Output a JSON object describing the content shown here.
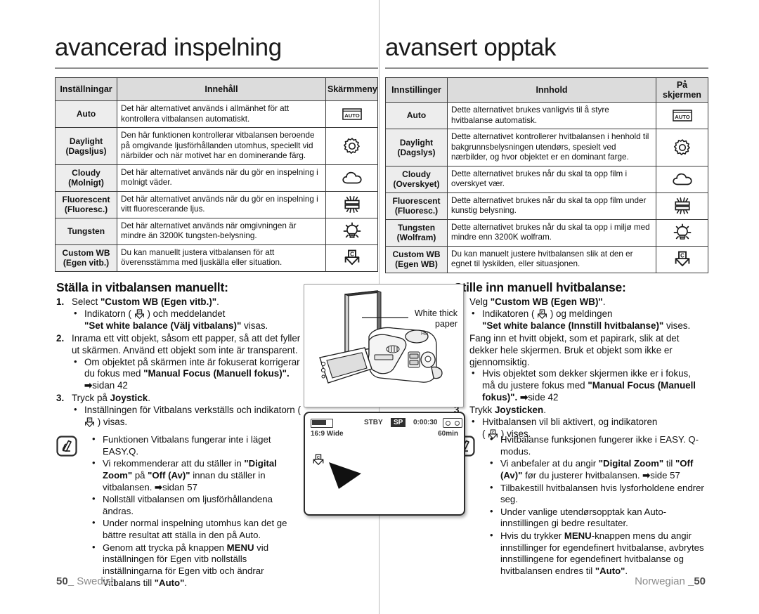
{
  "left": {
    "chapter_title": "avancerad inspelning",
    "table": {
      "headers": [
        "Inställningar",
        "Innehåll",
        "Skärmmeny"
      ],
      "rows": [
        {
          "setting": "Auto",
          "content": "Det här alternativet används i allmänhet för att kontrollera vitbalansen automatiskt.",
          "icon": "auto-icon"
        },
        {
          "setting": "Daylight\n(Dagsljus)",
          "content": "Den här funktionen kontrollerar vitbalansen beroende på omgivande ljusförhållanden utomhus, speciellt vid närbilder och när motivet har en dominerande färg.",
          "icon": "daylight-sun-icon"
        },
        {
          "setting": "Cloudy\n(Molnigt)",
          "content": "Det här alternativet används när du gör en inspelning i molnigt väder.",
          "icon": "cloudy-icon"
        },
        {
          "setting": "Fluorescent\n(Fluoresc.)",
          "content": "Det här alternativet används när du gör en inspelning i vitt fluorescerande ljus.",
          "icon": "fluorescent-icon"
        },
        {
          "setting": "Tungsten",
          "content": "Det här alternativet används när omgivningen är mindre än 3200K tungsten-belysning.",
          "icon": "tungsten-icon"
        },
        {
          "setting": "Custom WB\n(Egen vitb.)",
          "content": "Du kan manuellt justera vitbalansen för att överensstämma med ljuskälla eller situation.",
          "icon": "custom-wb-icon"
        }
      ]
    },
    "howto_title": "Ställa in vitbalansen manuellt:",
    "steps": [
      {
        "num": "1.",
        "text_parts": [
          {
            "t": "Select ",
            "b": false
          },
          {
            "t": "\"Custom WB (Egen vitb.)\"",
            "b": true
          },
          {
            "t": ".",
            "b": false
          }
        ],
        "subs": [
          {
            "parts": [
              {
                "t": "Indikatorn ( ",
                "b": false
              },
              {
                "icon": "custom-wb-icon"
              },
              {
                "t": " ) och meddelandet ",
                "b": false
              },
              {
                "br": true
              },
              {
                "t": "\"Set white balance (Välj vitbalans)\"",
                "b": true
              },
              {
                "t": " visas.",
                "b": false
              }
            ]
          }
        ]
      },
      {
        "num": "2.",
        "text_parts": [
          {
            "t": "Inrama ett vitt objekt, såsom ett papper, så att det fyller ut skärmen. Använd ett objekt som inte är transparent.",
            "b": false
          }
        ],
        "subs": [
          {
            "parts": [
              {
                "t": "Om objektet på skärmen inte är fokuserat korrigerar du fokus med ",
                "b": false
              },
              {
                "t": "\"Manual Focus (Manuell fokus)\".",
                "b": true
              },
              {
                "t": " ",
                "b": false
              },
              {
                "t": "➡",
                "b": true
              },
              {
                "t": "sidan 42",
                "b": false
              }
            ]
          }
        ]
      },
      {
        "num": "3.",
        "text_parts": [
          {
            "t": "Tryck på ",
            "b": false
          },
          {
            "t": "Joystick",
            "b": true
          },
          {
            "t": ".",
            "b": false
          }
        ],
        "subs": [
          {
            "parts": [
              {
                "t": "Inställningen för Vitbalans verkställs och indikatorn ( ",
                "b": false
              },
              {
                "icon": "custom-wb-icon"
              },
              {
                "t": " ) visas.",
                "b": false
              }
            ]
          }
        ]
      }
    ],
    "notes": [
      {
        "parts": [
          {
            "t": "Funktionen Vitbalans fungerar inte i läget EASY.Q.",
            "b": false
          }
        ]
      },
      {
        "parts": [
          {
            "t": "Vi rekommenderar att du ställer in ",
            "b": false
          },
          {
            "t": "\"Digital Zoom\"",
            "b": true
          },
          {
            "t": " på ",
            "b": false
          },
          {
            "t": "\"Off (Av)\"",
            "b": true
          },
          {
            "t": " innan du ställer in vitbalansen. ",
            "b": false
          },
          {
            "t": "➡",
            "b": true
          },
          {
            "t": "sidan 57",
            "b": false
          }
        ]
      },
      {
        "parts": [
          {
            "t": "Nollställ vitbalansen om ljusförhållandena ändras.",
            "b": false
          }
        ]
      },
      {
        "parts": [
          {
            "t": "Under normal inspelning utomhus kan det ge bättre resultat att ställa in den på Auto.",
            "b": false
          }
        ]
      },
      {
        "parts": [
          {
            "t": "Genom att trycka på knappen ",
            "b": false
          },
          {
            "t": "MENU",
            "b": true
          },
          {
            "t": " vid inställningen för Egen vitb nollställs inställningarna för Egen vitb och ändrar Vitbalans till ",
            "b": false
          },
          {
            "t": "\"Auto\"",
            "b": true
          },
          {
            "t": ".",
            "b": false
          }
        ]
      }
    ],
    "footer_page": "50",
    "footer_language": "Swedish"
  },
  "right": {
    "chapter_title": "avansert opptak",
    "table": {
      "headers": [
        "Innstillinger",
        "Innhold",
        "På skjermen"
      ],
      "rows": [
        {
          "setting": "Auto",
          "content": "Dette alternativet brukes vanligvis til å styre hvitbalanse automatisk.",
          "icon": "auto-icon"
        },
        {
          "setting": "Daylight\n(Dagslys)",
          "content": "Dette alternativet kontrollerer hvitbalansen i henhold til bakgrunnsbelysningen utendørs, spesielt ved nærbilder, og hvor objektet er en dominant farge.",
          "icon": "daylight-sun-icon"
        },
        {
          "setting": "Cloudy\n(Overskyet)",
          "content": "Dette alternativet brukes når du skal ta opp film i overskyet vær.",
          "icon": "cloudy-icon"
        },
        {
          "setting": "Fluorescent\n(Fluoresc.)",
          "content": "Dette alternativet brukes når du skal ta opp film under kunstig belysning.",
          "icon": "fluorescent-icon"
        },
        {
          "setting": "Tungsten\n(Wolfram)",
          "content": "Dette alternativet brukes når du skal ta opp i miljø med mindre enn 3200K wolfram.",
          "icon": "tungsten-icon"
        },
        {
          "setting": "Custom WB\n(Egen WB)",
          "content": "Du kan manuelt justere hvitbalansen slik at den er egnet til lyskilden, eller situasjonen.",
          "icon": "custom-wb-icon"
        }
      ]
    },
    "howto_title": "Stille inn manuell hvitbalanse:",
    "steps": [
      {
        "num": "1.",
        "text_parts": [
          {
            "t": "Velg ",
            "b": false
          },
          {
            "t": "\"Custom WB (Egen WB)\"",
            "b": true
          },
          {
            "t": ".",
            "b": false
          }
        ],
        "subs": [
          {
            "parts": [
              {
                "t": "Indikatoren ( ",
                "b": false
              },
              {
                "icon": "custom-wb-icon"
              },
              {
                "t": " ) og meldingen ",
                "b": false
              },
              {
                "br": true
              },
              {
                "t": "\"Set white balance (Innstill hvitbalanse)\"",
                "b": true
              },
              {
                "t": " vises.",
                "b": false
              }
            ]
          }
        ]
      },
      {
        "num": "2.",
        "text_parts": [
          {
            "t": "Fang inn et hvitt objekt, som et papirark, slik at det dekker hele skjermen. Bruk et objekt som ikke er gjennomsiktig.",
            "b": false
          }
        ],
        "subs": [
          {
            "parts": [
              {
                "t": "Hvis objektet som dekker skjermen ikke er i fokus, må du justere fokus med ",
                "b": false
              },
              {
                "t": "\"Manual Focus (Manuell fokus)\".",
                "b": true
              },
              {
                "t": " ",
                "b": false
              },
              {
                "t": "➡",
                "b": true
              },
              {
                "t": "side 42",
                "b": false
              }
            ]
          }
        ]
      },
      {
        "num": "3.",
        "text_parts": [
          {
            "t": "Trykk ",
            "b": false
          },
          {
            "t": "Joysticken",
            "b": true
          },
          {
            "t": ".",
            "b": false
          }
        ],
        "subs": [
          {
            "parts": [
              {
                "t": "Hvitbalansen vil bli aktivert, og indikatoren ",
                "b": false
              },
              {
                "br": true
              },
              {
                "t": "( ",
                "b": false
              },
              {
                "icon": "custom-wb-icon"
              },
              {
                "t": " ) vises.",
                "b": false
              }
            ]
          }
        ]
      }
    ],
    "notes": [
      {
        "parts": [
          {
            "t": "Hvitbalanse funksjonen fungerer ikke i EASY. Q-modus.",
            "b": false
          }
        ]
      },
      {
        "parts": [
          {
            "t": "Vi anbefaler at du angir ",
            "b": false
          },
          {
            "t": "\"Digital Zoom\"",
            "b": true
          },
          {
            "t": " til ",
            "b": false
          },
          {
            "t": "\"Off (Av)\"",
            "b": true
          },
          {
            "t": " før du justerer hvitbalansen. ",
            "b": false
          },
          {
            "t": "➡",
            "b": true
          },
          {
            "t": "side 57",
            "b": false
          }
        ]
      },
      {
        "parts": [
          {
            "t": "Tilbakestill hvitbalansen hvis lysforholdene endrer seg.",
            "b": false
          }
        ]
      },
      {
        "parts": [
          {
            "t": "Under vanlige utendørsopptak kan Auto-innstillingen gi bedre resultater.",
            "b": false
          }
        ]
      },
      {
        "parts": [
          {
            "t": "Hvis du trykker ",
            "b": false
          },
          {
            "t": "MENU",
            "b": true
          },
          {
            "t": "-knappen mens du angir innstillinger for egendefinert hvitbalanse, avbrytes innstillingene for egendefinert hvitbalanse og hvitbalansen endres til ",
            "b": false
          },
          {
            "t": "\"Auto\"",
            "b": true
          },
          {
            "t": ".",
            "b": false
          }
        ]
      }
    ],
    "footer_page": "50",
    "footer_language": "Norwegian"
  },
  "figures": {
    "camera": {
      "label_line1": "White thick",
      "label_line2": "paper"
    },
    "lcd": {
      "status_mode": "STBY",
      "quality": "SP",
      "timecode": "0:00:30",
      "aspect": "16:9 Wide",
      "tape_remaining": "60min"
    }
  }
}
